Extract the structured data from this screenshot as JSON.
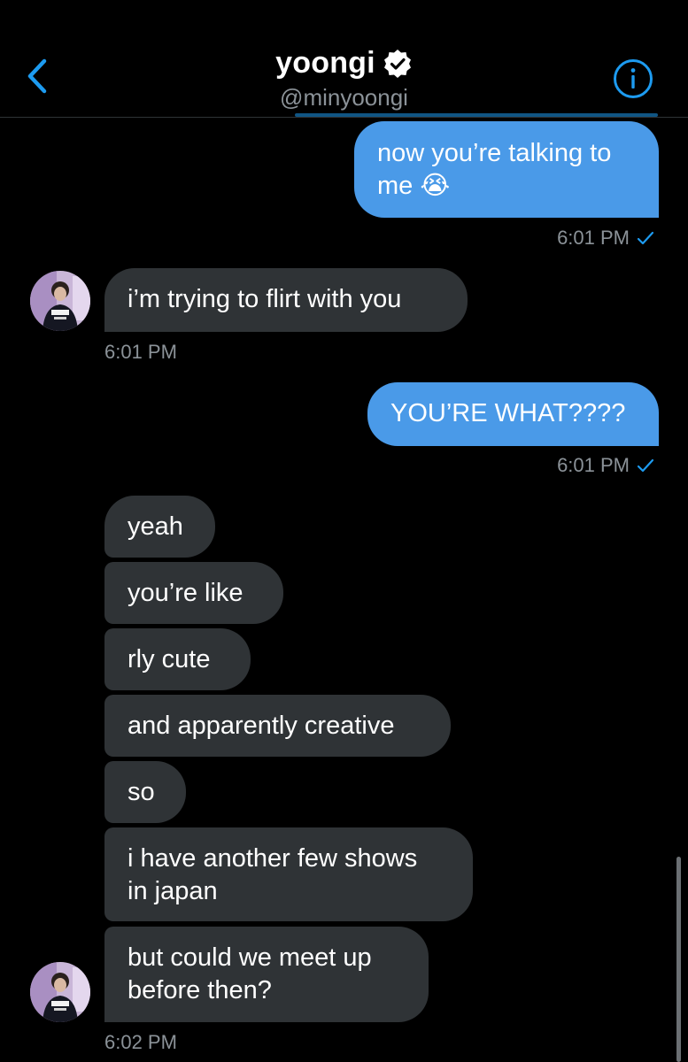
{
  "header": {
    "title": "yoongi",
    "handle": "@minyoongi",
    "back_icon": "chevron-left-icon",
    "verified_icon": "verified-badge-icon",
    "info_icon": "info-icon"
  },
  "colors": {
    "background": "#000000",
    "accent": "#1d9bf0",
    "outgoing_bubble": "#4a9ae8",
    "incoming_bubble": "#2f3336",
    "muted_text": "#8b9298"
  },
  "messages": [
    {
      "direction": "outgoing",
      "text": "now you’re talking to me 😭",
      "line1": "now you’re talking to",
      "line2": "me 😭"
    },
    {
      "direction": "outgoing",
      "time": "6:01 PM",
      "status_icon": "sent-check-icon"
    },
    {
      "direction": "incoming",
      "text": "i’m trying to flirt with you"
    },
    {
      "direction": "incoming",
      "time": "6:01 PM"
    },
    {
      "direction": "outgoing",
      "text": "YOU’RE WHAT????"
    },
    {
      "direction": "outgoing",
      "time": "6:01 PM",
      "status_icon": "sent-check-icon"
    },
    {
      "direction": "incoming",
      "text": "yeah"
    },
    {
      "direction": "incoming",
      "text": "you’re like"
    },
    {
      "direction": "incoming",
      "text": "rly cute"
    },
    {
      "direction": "incoming",
      "text": "and apparently creative"
    },
    {
      "direction": "incoming",
      "text": "so"
    },
    {
      "direction": "incoming",
      "line1": "i have another few shows",
      "line2": "in japan"
    },
    {
      "direction": "incoming",
      "line1": "but could we meet up",
      "line2": "before then?"
    },
    {
      "direction": "incoming",
      "time": "6:02 PM"
    }
  ]
}
